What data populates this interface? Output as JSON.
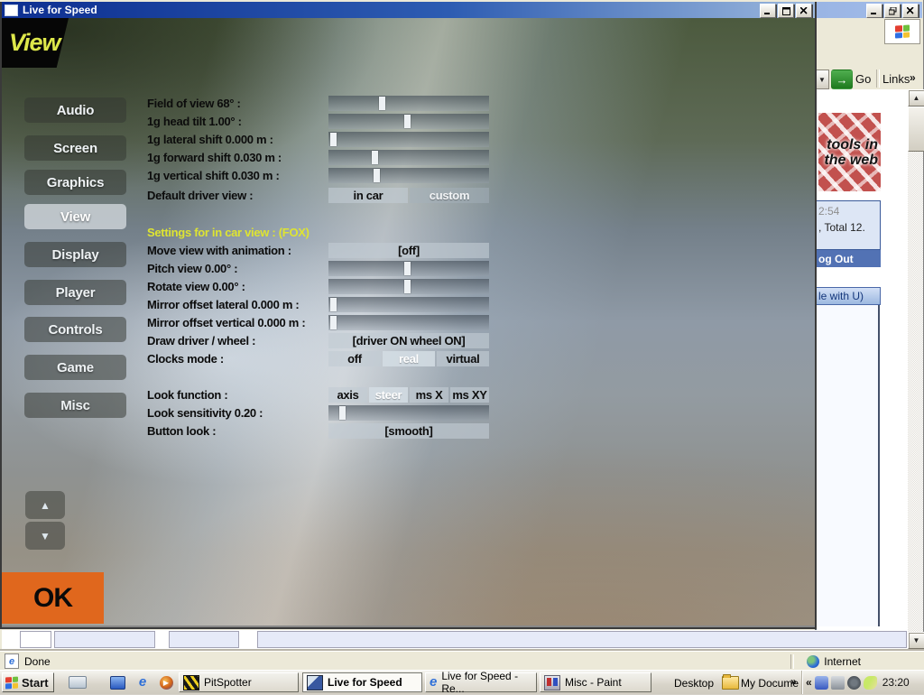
{
  "lfs": {
    "title": "Live for Speed",
    "logo": "View",
    "sidebar": [
      "Audio",
      "Screen",
      "Graphics",
      "View",
      "Display",
      "Player",
      "Controls",
      "Game",
      "Misc"
    ],
    "fov": {
      "label": "Field of view 68° :",
      "pos": 33
    },
    "headTilt": {
      "label": "1g head tilt 1.00° :",
      "pos": 49
    },
    "latShift": {
      "label": "1g lateral shift 0.000 m :",
      "pos": 1
    },
    "fwdShift": {
      "label": "1g forward shift 0.030 m :",
      "pos": 28
    },
    "vertShift": {
      "label": "1g vertical shift 0.030 m :",
      "pos": 29
    },
    "driverView": {
      "label": "Default driver view :",
      "options": [
        "in car",
        "custom"
      ],
      "selected": "in car"
    },
    "sectionTitle": "Settings for in car view : (FOX)",
    "moveView": {
      "label": "Move view with animation :",
      "value": "[off]"
    },
    "pitch": {
      "label": "Pitch view 0.00° :",
      "pos": 49
    },
    "rotate": {
      "label": "Rotate view 0.00° :",
      "pos": 49
    },
    "mirrorLat": {
      "label": "Mirror offset lateral 0.000 m :",
      "pos": 1
    },
    "mirrorVert": {
      "label": "Mirror offset vertical 0.000 m :",
      "pos": 1
    },
    "drawDriver": {
      "label": "Draw driver / wheel :",
      "value": "[driver ON wheel ON]"
    },
    "clocks": {
      "label": "Clocks mode :",
      "options": [
        "off",
        "real",
        "virtual"
      ],
      "selected": "real"
    },
    "lookFunction": {
      "label": "Look function :",
      "options": [
        "axis",
        "steer",
        "ms X",
        "ms XY"
      ],
      "selected": "steer"
    },
    "lookSens": {
      "label": "Look sensitivity 0.20 :",
      "pos": 7
    },
    "buttonLook": {
      "label": "Button look :",
      "value": "[smooth]"
    },
    "ok": "OK",
    "scrollUp": "▲",
    "scrollDown": "▼"
  },
  "browser": {
    "go": "Go",
    "goArrow": "→",
    "links": "Links",
    "chevron": "»",
    "ddArrow": "▼",
    "sbUp": "▲",
    "sbDown": "▼",
    "banner": {
      "line1": "tools in",
      "line2": "the web"
    },
    "time": "2:54",
    "total": ", Total 12.",
    "logout": "og Out",
    "header2": "le with U)",
    "status": {
      "done": "Done",
      "zone": "Internet",
      "eicon": "e"
    }
  },
  "taskbar": {
    "start": "Start",
    "tasks": [
      {
        "label": "PitSpotter"
      },
      {
        "label": "Live for Speed"
      },
      {
        "label": "Live for Speed - Re..."
      },
      {
        "label": "Misc - Paint"
      }
    ],
    "desktop": "Desktop",
    "mydocs": "My Docume",
    "chevR": "»",
    "chevL": "«",
    "clock": "23:20",
    "ieQuickE": "e"
  },
  "colors": {
    "accent_orange": "#e0671d",
    "lfs_yellow": "#dee432",
    "titlebar_blue": "#0d2f91",
    "logout_blue": "#5272b4"
  }
}
